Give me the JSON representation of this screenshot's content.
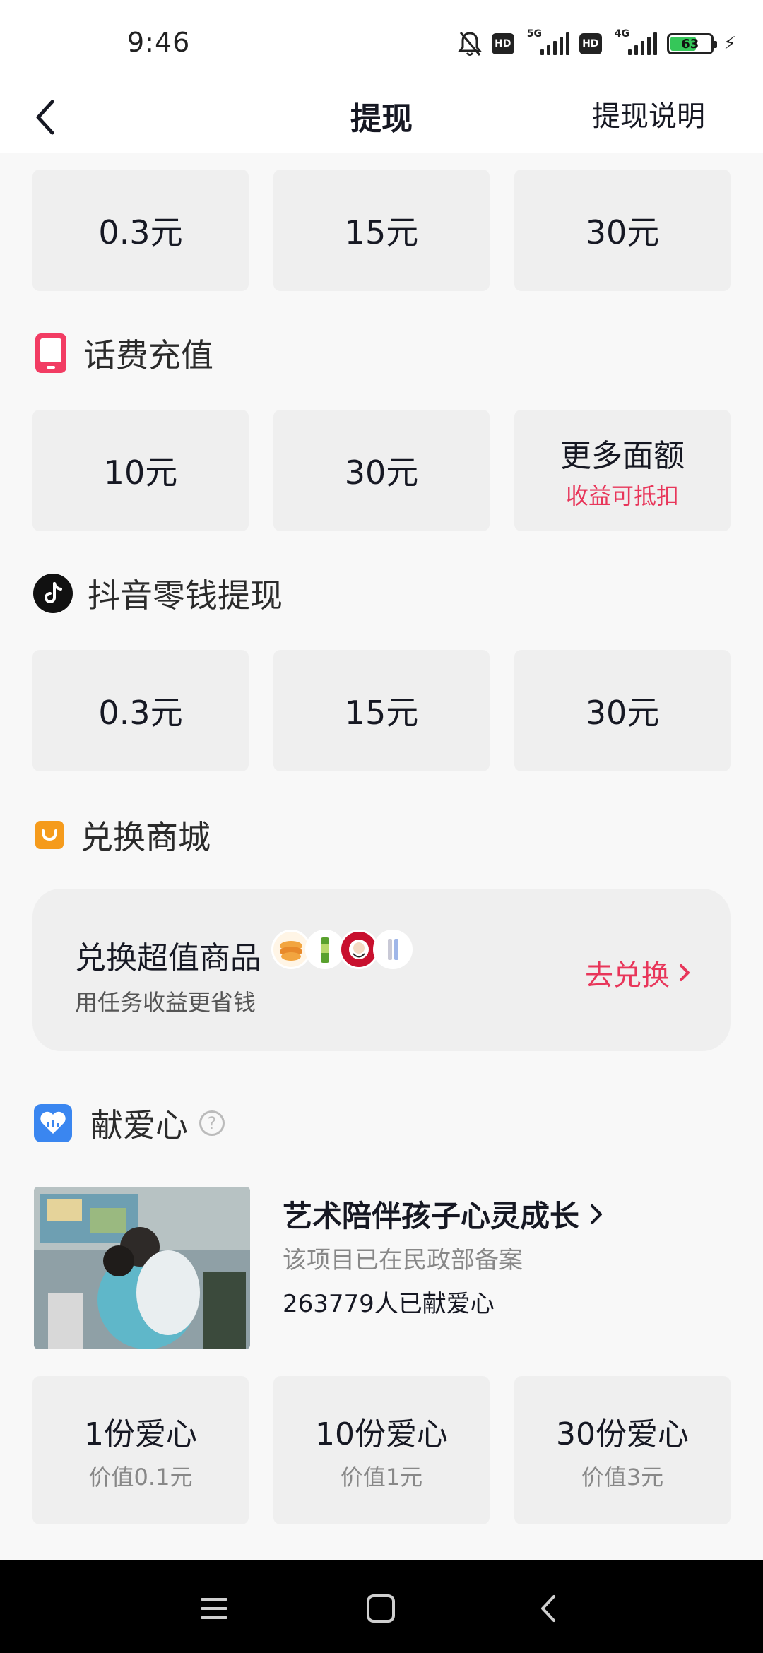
{
  "status_bar": {
    "time": "9:46",
    "network_1": "5G",
    "network_2": "4G",
    "hd_label": "HD",
    "battery": "63",
    "icons": [
      "mute-icon",
      "hd-icon",
      "signal-icon",
      "battery-icon",
      "charging-icon"
    ]
  },
  "nav": {
    "title": "提现",
    "help_link": "提现说明"
  },
  "cash_top": [
    "0.3元",
    "15元",
    "30元"
  ],
  "phone_recharge": {
    "title": "话费充值",
    "options": [
      "10元",
      "30元"
    ],
    "more_label": "更多面额",
    "more_sub": "收益可抵扣"
  },
  "douyin_wallet": {
    "title": "抖音零钱提现",
    "options": [
      "0.3元",
      "15元",
      "30元"
    ]
  },
  "mall": {
    "title": "兑换商城",
    "card_title": "兑换超值商品",
    "card_desc": "用任务收益更省钱",
    "cta": "去兑换"
  },
  "charity": {
    "title": "献爱心",
    "help": "?",
    "project_title": "艺术陪伴孩子心灵成长",
    "project_note": "该项目已在民政部备案",
    "donor_count": "263779人已献爱心",
    "options": [
      {
        "label": "1份爱心",
        "value": "价值0.1元"
      },
      {
        "label": "10份爱心",
        "value": "价值1元"
      },
      {
        "label": "30份爱心",
        "value": "价值3元"
      }
    ]
  },
  "colors": {
    "accent": "#e8365a",
    "tile_bg": "#efefef",
    "page_bg": "#f8f8f8",
    "mall_icon": "#f59b1c",
    "charity_icon": "#3a86f0"
  }
}
